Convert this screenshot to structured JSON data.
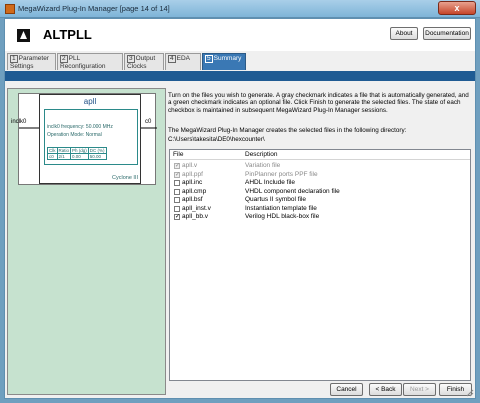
{
  "window": {
    "title": "MegaWizard Plug-In Manager [page 14 of 14]",
    "close": "x"
  },
  "header": {
    "logo_text": "ALTPLL",
    "about_label": "About",
    "documentation_label": "Documentation"
  },
  "tabs": [
    {
      "num": "1",
      "line1": "Parameter",
      "line2": "Settings"
    },
    {
      "num": "2",
      "line1": "PLL",
      "line2": "Reconfiguration"
    },
    {
      "num": "3",
      "line1": "Output",
      "line2": "Clocks"
    },
    {
      "num": "4",
      "line1": "EDA",
      "line2": ""
    },
    {
      "num": "5",
      "line1": "Summary",
      "line2": ""
    }
  ],
  "symbol": {
    "name": "apll",
    "input_port": "inclk0",
    "output_port": "c0",
    "freq_line": "inclk0 frequency: 50.000 MHz",
    "mode_line": "Operation Mode: Normal",
    "table_header": [
      "Clk",
      "Ratio",
      "Ph (dg)",
      "DC (%)"
    ],
    "table_row": [
      "c0",
      "2/1",
      "0.00",
      "50.00"
    ],
    "device": "Cyclone III"
  },
  "instructions": "Turn on the files you wish to generate. A gray checkmark indicates a file that is automatically generated, and a green checkmark indicates an optional file. Click Finish to generate the selected files. The state of each checkbox is maintained in subsequent MegaWizard Plug-In Manager sessions.",
  "dir_label": "The MegaWizard Plug-In Manager creates the selected files in the following directory:",
  "dir_path": "C:\\Users\\takesita\\DE0\\hexcounter\\",
  "file_table": {
    "col_file": "File",
    "col_desc": "Description",
    "rows": [
      {
        "file": "apll.v",
        "desc": "Variation file",
        "checked": true,
        "disabled": true,
        "check": "✓"
      },
      {
        "file": "apll.ppf",
        "desc": "PinPlanner ports PPF file",
        "checked": true,
        "disabled": true,
        "check": "✓"
      },
      {
        "file": "apll.inc",
        "desc": "AHDL Include file",
        "checked": false,
        "disabled": false,
        "check": ""
      },
      {
        "file": "apll.cmp",
        "desc": "VHDL component declaration file",
        "checked": false,
        "disabled": false,
        "check": ""
      },
      {
        "file": "apll.bsf",
        "desc": "Quartus II symbol file",
        "checked": false,
        "disabled": false,
        "check": ""
      },
      {
        "file": "apll_inst.v",
        "desc": "Instantiation template file",
        "checked": false,
        "disabled": false,
        "check": ""
      },
      {
        "file": "apll_bb.v",
        "desc": "Verilog HDL black-box file",
        "checked": true,
        "disabled": false,
        "check": "✓"
      }
    ]
  },
  "buttons": {
    "cancel": "Cancel",
    "back": "< Back",
    "next": "Next >",
    "finish": "Finish"
  },
  "colors": {
    "accent": "#1f5b93",
    "tab_active": "#3a78b4",
    "left_panel": "#c6e2cf"
  }
}
